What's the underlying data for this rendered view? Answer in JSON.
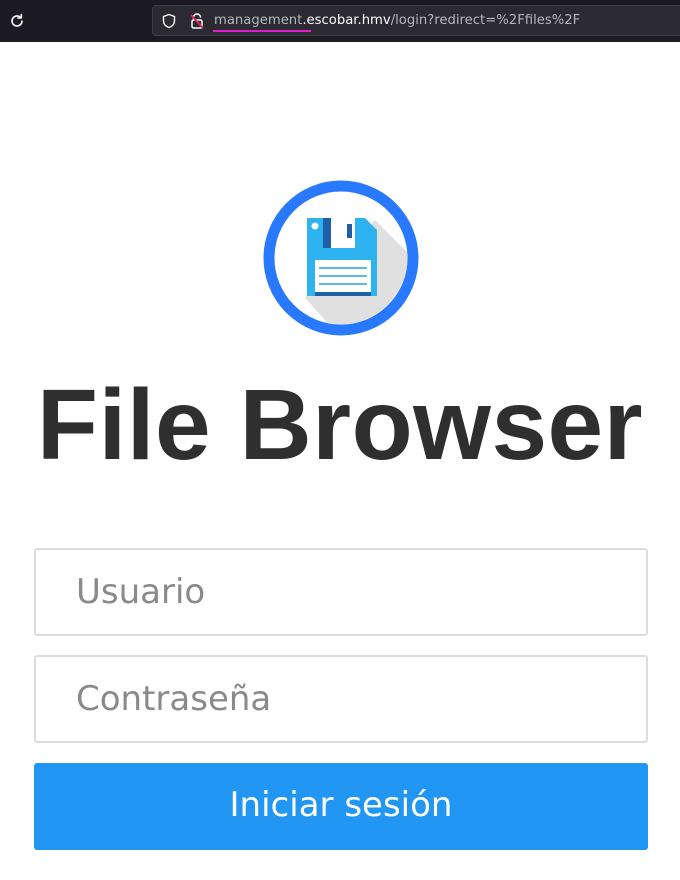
{
  "browser": {
    "url_subdomain": "management",
    "url_domain": ".escobar.hmv",
    "url_path": "/login?redirect=%2Ffiles%2F"
  },
  "app": {
    "title": "File Browser",
    "logo_icon": "floppy-disk-icon"
  },
  "login": {
    "username_placeholder": "Usuario",
    "password_placeholder": "Contraseña",
    "submit_label": "Iniciar sesión"
  },
  "colors": {
    "accent": "#2196f3",
    "logo_ring": "#2979ff",
    "title_text": "#2f2f2f",
    "url_highlight": "#e01cc8"
  }
}
